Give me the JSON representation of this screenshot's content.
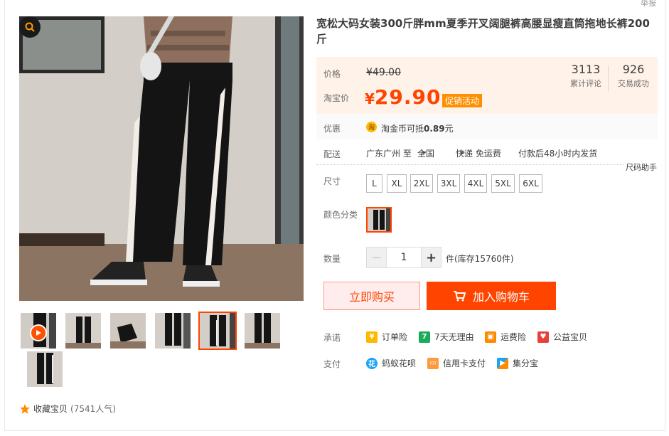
{
  "header": {
    "report_label": "举报"
  },
  "product": {
    "title": "宽松大码女装300斤胖mm夏季开叉阔腿裤高腰显瘦直筒拖地长裤200斤"
  },
  "price": {
    "label": "价格",
    "original": "¥49.00",
    "promo_label": "淘宝价",
    "currency": "¥",
    "current": "29.90",
    "promo_badge": "促销活动"
  },
  "stats": [
    {
      "value": "3113",
      "label": "累计评论"
    },
    {
      "value": "926",
      "label": "交易成功"
    }
  ],
  "discount": {
    "label": "优惠",
    "coin_icon": "淘",
    "text_prefix": "淘金币可抵",
    "amount": "0.89",
    "text_suffix": "元"
  },
  "shipping": {
    "label": "配送",
    "from": "广东广州 至",
    "to": "全国",
    "method": "快递 免运费",
    "dispatch": "付款后48小时内发货"
  },
  "size_help": "尺码助手",
  "sizes": {
    "label": "尺寸",
    "options": [
      "L",
      "XL",
      "2XL",
      "3XL",
      "4XL",
      "5XL",
      "6XL"
    ]
  },
  "colors": {
    "label": "颜色分类"
  },
  "quantity": {
    "label": "数量",
    "minus": "−",
    "value": "1",
    "plus": "+",
    "stock": "件(库存15760件)"
  },
  "actions": {
    "buy_now": "立即购买",
    "add_cart": "加入购物车"
  },
  "promise": {
    "label": "承诺",
    "items": [
      {
        "icon": "order-insurance-icon",
        "text": "订单险",
        "color": "#ffb800"
      },
      {
        "icon": "seven-day-return-icon",
        "text": "7天无理由",
        "color": "#1aac5a"
      },
      {
        "icon": "freight-insurance-icon",
        "text": "运费险",
        "color": "#ff8a00"
      },
      {
        "icon": "charity-icon",
        "text": "公益宝贝",
        "color": "#e8413c"
      }
    ]
  },
  "payment": {
    "label": "支付",
    "items": [
      {
        "icon": "huabei-icon",
        "text": "蚂蚁花呗",
        "color": "#1aa3f5"
      },
      {
        "icon": "credit-card-icon",
        "text": "信用卡支付",
        "color": "#ff9a3c"
      },
      {
        "icon": "jifenbao-icon",
        "text": "集分宝",
        "color": "#1aa3f5"
      }
    ]
  },
  "favorite": {
    "label": "收藏宝贝",
    "count": "(7541人气)"
  },
  "colors_theme": {
    "accent": "#ff4400",
    "price": "#ff4400",
    "promo_bg": "#fff2e8"
  }
}
